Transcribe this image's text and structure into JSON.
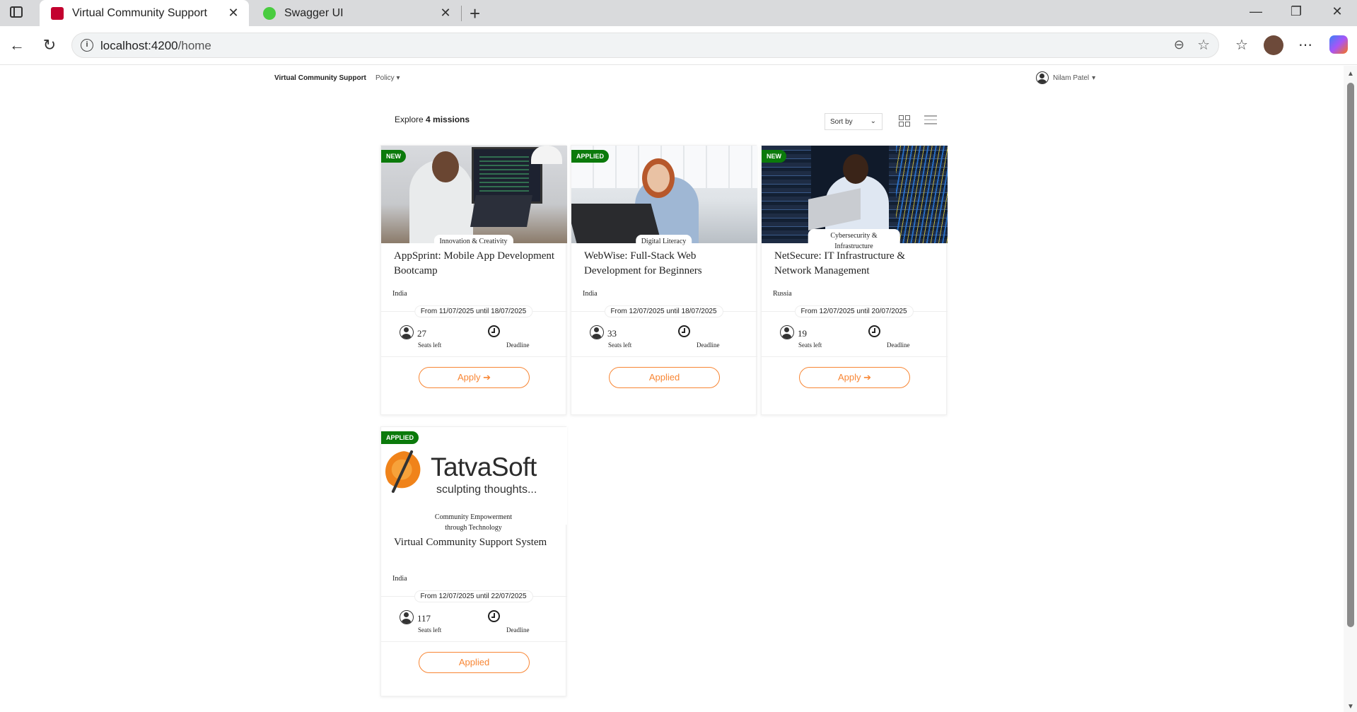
{
  "browser": {
    "tabs": [
      {
        "title": "Virtual Community Support",
        "active": true
      },
      {
        "title": "Swagger UI",
        "active": false
      }
    ],
    "url_host": "localhost:4200",
    "url_path": "/home"
  },
  "app": {
    "brand": "Virtual Community Support",
    "policy": "Policy",
    "user": "Nilam Patel"
  },
  "toolbar": {
    "explore_prefix": "Explore",
    "explore_count": "4 missions",
    "sort_label": "Sort by"
  },
  "missions": [
    {
      "badge": "NEW",
      "theme": "Innovation & Creativity",
      "title": "AppSprint: Mobile App Development Bootcamp",
      "country": "India",
      "dates": "From 11/07/2025 until 18/07/2025",
      "seats": "27",
      "seats_label": "Seats left",
      "deadline_label": "Deadline",
      "button": "Apply ➔"
    },
    {
      "badge": "APPLIED",
      "theme": "Digital Literacy",
      "title": "WebWise: Full-Stack Web Development for Beginners",
      "country": "India",
      "dates": "From 12/07/2025 until 18/07/2025",
      "seats": "33",
      "seats_label": "Seats left",
      "deadline_label": "Deadline",
      "button": "Applied"
    },
    {
      "badge": "NEW",
      "theme": "Cybersecurity & Infrastructure",
      "title": "NetSecure: IT Infrastructure & Network Management",
      "country": "Russia",
      "dates": "From 12/07/2025 until 20/07/2025",
      "seats": "19",
      "seats_label": "Seats left",
      "deadline_label": "Deadline",
      "button": "Apply ➔"
    },
    {
      "badge": "APPLIED",
      "theme": "Community Empowerment through Technology",
      "title": "Virtual Community Support System",
      "country": "India",
      "dates": "From 12/07/2025 until 22/07/2025",
      "seats": "117",
      "seats_label": "Seats left",
      "deadline_label": "Deadline",
      "button": "Applied",
      "logo_text": "TatvaSoft",
      "logo_tagline": "sculpting thoughts..."
    }
  ],
  "colors": {
    "accent": "#f88634",
    "badge": "#0b7a0b"
  }
}
